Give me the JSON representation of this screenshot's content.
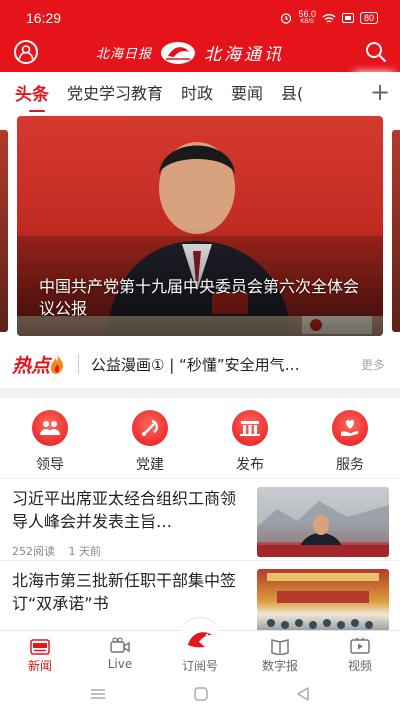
{
  "status_bar": {
    "time": "16:29",
    "net_speed": "56.0",
    "net_unit": "KB/S",
    "battery": "80"
  },
  "header": {
    "brand_left": "北海日报",
    "brand_right": "北海通讯"
  },
  "tabs": [
    "头条",
    "党史学习教育",
    "时政",
    "要闻",
    "县("
  ],
  "tabs_more": "+",
  "banner": {
    "title": "中国共产党第十九届中央委员会第六次全体会议公报"
  },
  "hot": {
    "logo": "热点",
    "text": "公益漫画① | “秒懂”安全用气…",
    "more": "更多"
  },
  "quick_links": [
    {
      "label": "领导",
      "icon": "leaders-icon"
    },
    {
      "label": "党建",
      "icon": "party-emblem-icon"
    },
    {
      "label": "发布",
      "icon": "release-icon"
    },
    {
      "label": "服务",
      "icon": "service-heart-icon"
    }
  ],
  "news": [
    {
      "title": "习近平出席亚太经合组织工商领导人峰会并发表主旨…",
      "reads": "252阅读",
      "time": "1 天前"
    },
    {
      "title": "北海市第三批新任职干部集中签订“双承诺”书",
      "reads": "",
      "time": ""
    }
  ],
  "bottom_nav": [
    {
      "label": "新闻",
      "active": true
    },
    {
      "label": "Live",
      "active": false
    },
    {
      "label": "订阅号",
      "active": false
    },
    {
      "label": "数字报",
      "active": false
    },
    {
      "label": "视频",
      "active": false
    }
  ],
  "colors": {
    "primary": "#e5141b",
    "text": "#222222",
    "muted": "#888888"
  }
}
